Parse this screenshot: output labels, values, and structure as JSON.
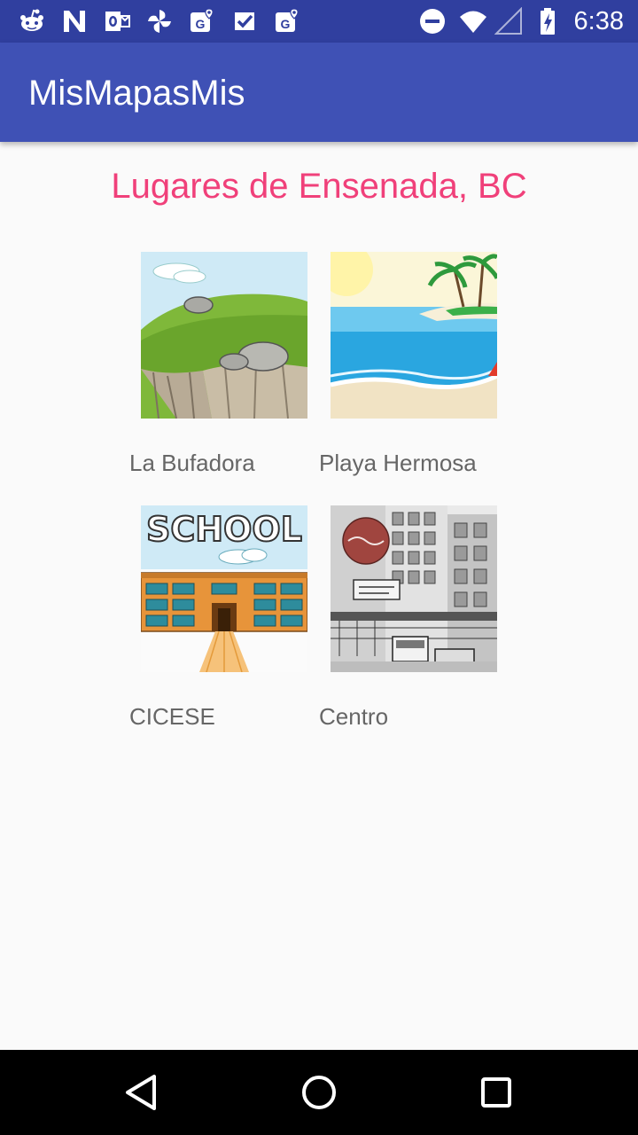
{
  "status_bar": {
    "time": "6:38",
    "left_icons": [
      "reddit-icon",
      "n-app-icon",
      "outlook-icon",
      "pinwheel-icon",
      "maps-icon",
      "inbox-check-icon",
      "maps-icon"
    ],
    "right_icons": [
      "do-not-disturb-icon",
      "wifi-icon",
      "signal-icon",
      "battery-charging-icon"
    ]
  },
  "app_bar": {
    "title": "MisMapasMis",
    "color": "#3f51b5",
    "status_color": "#303f9f"
  },
  "main": {
    "heading": "Lugares de Ensenada, BC",
    "heading_color": "#f0407a",
    "places": [
      {
        "label": "La Bufadora",
        "image": "cliff-illustration"
      },
      {
        "label": "Playa Hermosa",
        "image": "beach-illustration"
      },
      {
        "label": "CICESE",
        "image": "school-illustration"
      },
      {
        "label": "Centro",
        "image": "city-street-sketch"
      }
    ]
  },
  "nav_bar": {
    "buttons": [
      "back-icon",
      "home-icon",
      "recents-icon"
    ]
  }
}
